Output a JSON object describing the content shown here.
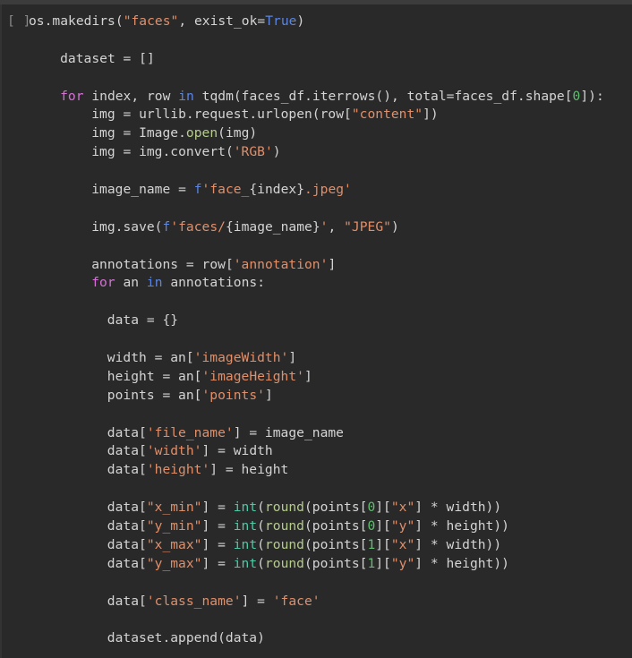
{
  "cell": {
    "run_indicator": "[ ]",
    "language": "python",
    "background_color": "#292929",
    "top_bar_color": "#3c3c3c",
    "default_text_color": "#d4d4d4"
  },
  "palette": {
    "plain": "#d4d4d4",
    "keyword": "#d670d6",
    "operator_keyword": "#5c85e0",
    "string": "#e08f6a",
    "number": "#5fbf6f",
    "builtin": "#4ec9a7",
    "function": "#b5cc8e",
    "gutter": "#8a8a8a"
  },
  "code_lines": [
    {
      "indent": 0,
      "tokens": [
        {
          "t": "os.makedirs(",
          "c": "plain"
        },
        {
          "t": "\"faces\"",
          "c": "string"
        },
        {
          "t": ", exist_ok=",
          "c": "plain"
        },
        {
          "t": "True",
          "c": "operator_keyword"
        },
        {
          "t": ")",
          "c": "plain"
        }
      ]
    },
    {
      "indent": 0,
      "tokens": []
    },
    {
      "indent": 4,
      "tokens": [
        {
          "t": "dataset = []",
          "c": "plain"
        }
      ]
    },
    {
      "indent": 0,
      "tokens": []
    },
    {
      "indent": 4,
      "tokens": [
        {
          "t": "for",
          "c": "keyword"
        },
        {
          "t": " index, row ",
          "c": "plain"
        },
        {
          "t": "in",
          "c": "operator_keyword"
        },
        {
          "t": " tqdm(faces_df.iterrows(), total=faces_df.shape[",
          "c": "plain"
        },
        {
          "t": "0",
          "c": "number"
        },
        {
          "t": "]):",
          "c": "plain"
        }
      ]
    },
    {
      "indent": 8,
      "tokens": [
        {
          "t": "img = urllib.request.urlopen(row[",
          "c": "plain"
        },
        {
          "t": "\"content\"",
          "c": "string"
        },
        {
          "t": "])",
          "c": "plain"
        }
      ]
    },
    {
      "indent": 8,
      "tokens": [
        {
          "t": "img = Image.",
          "c": "plain"
        },
        {
          "t": "open",
          "c": "function"
        },
        {
          "t": "(img)",
          "c": "plain"
        }
      ]
    },
    {
      "indent": 8,
      "tokens": [
        {
          "t": "img = img.convert(",
          "c": "plain"
        },
        {
          "t": "'RGB'",
          "c": "string"
        },
        {
          "t": ")",
          "c": "plain"
        }
      ]
    },
    {
      "indent": 0,
      "tokens": []
    },
    {
      "indent": 8,
      "tokens": [
        {
          "t": "image_name = ",
          "c": "plain"
        },
        {
          "t": "f",
          "c": "operator_keyword"
        },
        {
          "t": "'face_",
          "c": "string"
        },
        {
          "t": "{index}",
          "c": "plain"
        },
        {
          "t": ".jpeg'",
          "c": "string"
        }
      ]
    },
    {
      "indent": 0,
      "tokens": []
    },
    {
      "indent": 8,
      "tokens": [
        {
          "t": "img.save(",
          "c": "plain"
        },
        {
          "t": "f",
          "c": "operator_keyword"
        },
        {
          "t": "'faces/",
          "c": "string"
        },
        {
          "t": "{image_name}",
          "c": "plain"
        },
        {
          "t": "'",
          "c": "string"
        },
        {
          "t": ", ",
          "c": "plain"
        },
        {
          "t": "\"JPEG\"",
          "c": "string"
        },
        {
          "t": ")",
          "c": "plain"
        }
      ]
    },
    {
      "indent": 0,
      "tokens": []
    },
    {
      "indent": 8,
      "tokens": [
        {
          "t": "annotations = row[",
          "c": "plain"
        },
        {
          "t": "'annotation'",
          "c": "string"
        },
        {
          "t": "]",
          "c": "plain"
        }
      ]
    },
    {
      "indent": 8,
      "tokens": [
        {
          "t": "for",
          "c": "keyword"
        },
        {
          "t": " an ",
          "c": "plain"
        },
        {
          "t": "in",
          "c": "operator_keyword"
        },
        {
          "t": " annotations:",
          "c": "plain"
        }
      ]
    },
    {
      "indent": 0,
      "tokens": []
    },
    {
      "indent": 10,
      "tokens": [
        {
          "t": "data = {}",
          "c": "plain"
        }
      ]
    },
    {
      "indent": 0,
      "tokens": []
    },
    {
      "indent": 10,
      "tokens": [
        {
          "t": "width = an[",
          "c": "plain"
        },
        {
          "t": "'imageWidth'",
          "c": "string"
        },
        {
          "t": "]",
          "c": "plain"
        }
      ]
    },
    {
      "indent": 10,
      "tokens": [
        {
          "t": "height = an[",
          "c": "plain"
        },
        {
          "t": "'imageHeight'",
          "c": "string"
        },
        {
          "t": "]",
          "c": "plain"
        }
      ]
    },
    {
      "indent": 10,
      "tokens": [
        {
          "t": "points = an[",
          "c": "plain"
        },
        {
          "t": "'points'",
          "c": "string"
        },
        {
          "t": "]",
          "c": "plain"
        }
      ]
    },
    {
      "indent": 0,
      "tokens": []
    },
    {
      "indent": 10,
      "tokens": [
        {
          "t": "data[",
          "c": "plain"
        },
        {
          "t": "'file_name'",
          "c": "string"
        },
        {
          "t": "] = image_name",
          "c": "plain"
        }
      ]
    },
    {
      "indent": 10,
      "tokens": [
        {
          "t": "data[",
          "c": "plain"
        },
        {
          "t": "'width'",
          "c": "string"
        },
        {
          "t": "] = width",
          "c": "plain"
        }
      ]
    },
    {
      "indent": 10,
      "tokens": [
        {
          "t": "data[",
          "c": "plain"
        },
        {
          "t": "'height'",
          "c": "string"
        },
        {
          "t": "] = height",
          "c": "plain"
        }
      ]
    },
    {
      "indent": 0,
      "tokens": []
    },
    {
      "indent": 10,
      "tokens": [
        {
          "t": "data[",
          "c": "plain"
        },
        {
          "t": "\"x_min\"",
          "c": "string"
        },
        {
          "t": "] = ",
          "c": "plain"
        },
        {
          "t": "int",
          "c": "builtin"
        },
        {
          "t": "(",
          "c": "plain"
        },
        {
          "t": "round",
          "c": "function"
        },
        {
          "t": "(points[",
          "c": "plain"
        },
        {
          "t": "0",
          "c": "number"
        },
        {
          "t": "][",
          "c": "plain"
        },
        {
          "t": "\"x\"",
          "c": "string"
        },
        {
          "t": "] * width))",
          "c": "plain"
        }
      ]
    },
    {
      "indent": 10,
      "tokens": [
        {
          "t": "data[",
          "c": "plain"
        },
        {
          "t": "\"y_min\"",
          "c": "string"
        },
        {
          "t": "] = ",
          "c": "plain"
        },
        {
          "t": "int",
          "c": "builtin"
        },
        {
          "t": "(",
          "c": "plain"
        },
        {
          "t": "round",
          "c": "function"
        },
        {
          "t": "(points[",
          "c": "plain"
        },
        {
          "t": "0",
          "c": "number"
        },
        {
          "t": "][",
          "c": "plain"
        },
        {
          "t": "\"y\"",
          "c": "string"
        },
        {
          "t": "] * height))",
          "c": "plain"
        }
      ]
    },
    {
      "indent": 10,
      "tokens": [
        {
          "t": "data[",
          "c": "plain"
        },
        {
          "t": "\"x_max\"",
          "c": "string"
        },
        {
          "t": "] = ",
          "c": "plain"
        },
        {
          "t": "int",
          "c": "builtin"
        },
        {
          "t": "(",
          "c": "plain"
        },
        {
          "t": "round",
          "c": "function"
        },
        {
          "t": "(points[",
          "c": "plain"
        },
        {
          "t": "1",
          "c": "number"
        },
        {
          "t": "][",
          "c": "plain"
        },
        {
          "t": "\"x\"",
          "c": "string"
        },
        {
          "t": "] * width))",
          "c": "plain"
        }
      ]
    },
    {
      "indent": 10,
      "tokens": [
        {
          "t": "data[",
          "c": "plain"
        },
        {
          "t": "\"y_max\"",
          "c": "string"
        },
        {
          "t": "] = ",
          "c": "plain"
        },
        {
          "t": "int",
          "c": "builtin"
        },
        {
          "t": "(",
          "c": "plain"
        },
        {
          "t": "round",
          "c": "function"
        },
        {
          "t": "(points[",
          "c": "plain"
        },
        {
          "t": "1",
          "c": "number"
        },
        {
          "t": "][",
          "c": "plain"
        },
        {
          "t": "\"y\"",
          "c": "string"
        },
        {
          "t": "] * height))",
          "c": "plain"
        }
      ]
    },
    {
      "indent": 0,
      "tokens": []
    },
    {
      "indent": 10,
      "tokens": [
        {
          "t": "data[",
          "c": "plain"
        },
        {
          "t": "'class_name'",
          "c": "string"
        },
        {
          "t": "] = ",
          "c": "plain"
        },
        {
          "t": "'face'",
          "c": "string"
        }
      ]
    },
    {
      "indent": 0,
      "tokens": []
    },
    {
      "indent": 10,
      "tokens": [
        {
          "t": "dataset.append(data)",
          "c": "plain"
        }
      ]
    }
  ]
}
